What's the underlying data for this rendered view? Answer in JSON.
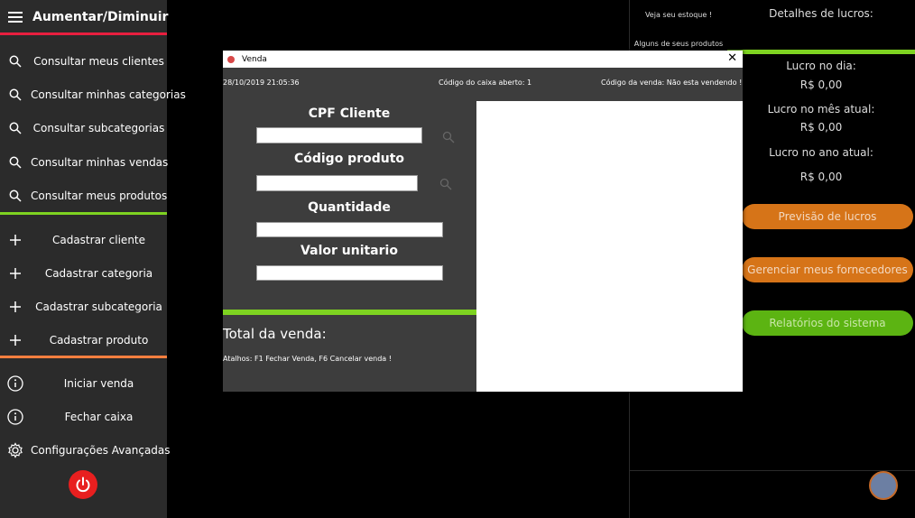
{
  "sidebar": {
    "title": "Aumentar/Diminuir",
    "consult_items": [
      {
        "label": "Consultar meus clientes",
        "icon": "search-icon"
      },
      {
        "label": "Consultar minhas categorias",
        "icon": "search-icon"
      },
      {
        "label": "Consultar subcategorias",
        "icon": "search-icon"
      },
      {
        "label": "Consultar minhas vendas",
        "icon": "search-icon"
      },
      {
        "label": "Consultar meus produtos",
        "icon": "search-icon"
      }
    ],
    "register_items": [
      {
        "label": "Cadastrar cliente",
        "icon": "plus-icon"
      },
      {
        "label": "Cadastrar categoria",
        "icon": "plus-icon"
      },
      {
        "label": "Cadastrar subcategoria",
        "icon": "plus-icon"
      },
      {
        "label": "Cadastrar produto",
        "icon": "plus-icon"
      }
    ],
    "action_items": [
      {
        "label": "Iniciar venda",
        "icon": "info-icon"
      },
      {
        "label": "Fechar caixa",
        "icon": "info-icon"
      },
      {
        "label": "Configurações Avançadas",
        "icon": "gear-icon"
      }
    ],
    "colors": {
      "sep1": "#e81f3f",
      "sep2": "#7ed321",
      "sep3": "#ff7f3f",
      "power": "#e81f1f"
    }
  },
  "middle": {
    "line1": "Veja seu estoque !",
    "line2": "Alguns de seus produtos"
  },
  "right": {
    "header": "Detalhes de lucros:",
    "day_label": "Lucro no dia:",
    "day_value": "R$ 0,00",
    "month_label": "Lucro no mês atual:",
    "month_value": "R$ 0,00",
    "year_label": "Lucro no ano atual:",
    "year_value": "R$ 0,00",
    "btn_forecast": "Previsão de lucros",
    "btn_suppliers": "Gerenciar meus fornecedores",
    "btn_reports": "Relatórios do sistema",
    "colors": {
      "orange": "#d67418",
      "green": "#5cb412",
      "accent": "#7ed321"
    }
  },
  "modal": {
    "title": "Venda",
    "datetime": "28/10/2019 21:05:36",
    "cashier_code": "Código do caixa aberto: 1",
    "sale_code": "Código da venda: Não esta vendendo !",
    "cpf_label": "CPF Cliente",
    "product_label": "Código produto",
    "quantity_label": "Quantidade",
    "unit_value_label": "Valor unitario",
    "total_label": "Total da venda:",
    "shortcuts": "Atalhos: F1 Fechar Venda, F6 Cancelar venda !"
  }
}
